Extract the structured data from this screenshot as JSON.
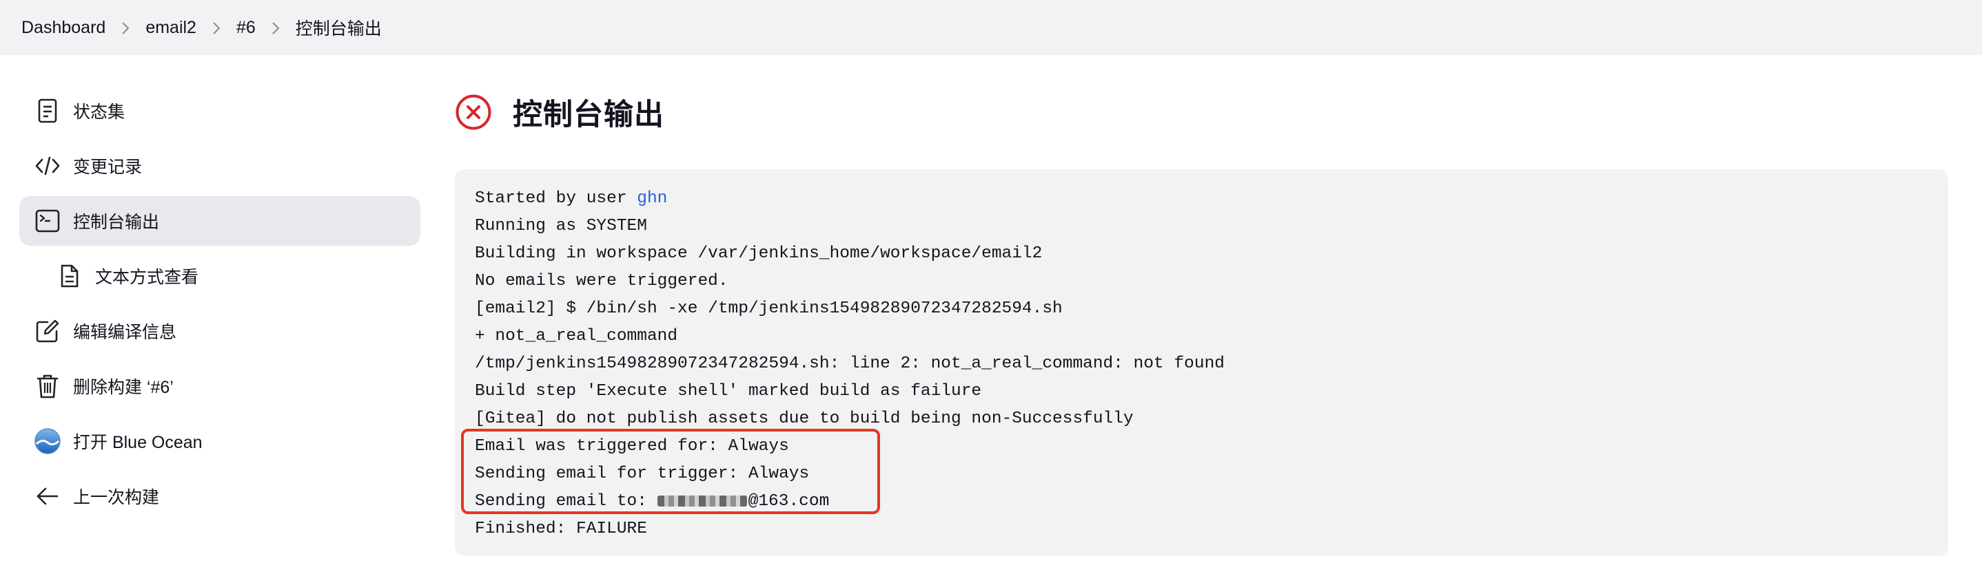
{
  "breadcrumb": {
    "items": [
      "Dashboard",
      "email2",
      "#6",
      "控制台输出"
    ]
  },
  "sidebar": {
    "items": [
      {
        "label": "状态集",
        "icon": "document-icon"
      },
      {
        "label": "变更记录",
        "icon": "code-icon"
      },
      {
        "label": "控制台输出",
        "icon": "terminal-icon",
        "active": true
      },
      {
        "label": "文本方式查看",
        "icon": "file-icon"
      },
      {
        "label": "编辑编译信息",
        "icon": "edit-icon"
      },
      {
        "label": "删除构建 ‘#6’",
        "icon": "trash-icon"
      },
      {
        "label": "打开 Blue Ocean",
        "icon": "blue-ocean-icon"
      },
      {
        "label": "上一次构建",
        "icon": "arrow-left-icon"
      }
    ]
  },
  "main": {
    "title": "控制台输出",
    "status": "failure",
    "status_color": "#d6262a"
  },
  "console": {
    "started_prefix": "Started by user ",
    "started_user": "ghn",
    "lines": [
      "Running as SYSTEM",
      "Building in workspace /var/jenkins_home/workspace/email2",
      "No emails were triggered.",
      "[email2] $ /bin/sh -xe /tmp/jenkins15498289072347282594.sh",
      "+ not_a_real_command",
      "/tmp/jenkins15498289072347282594.sh: line 2: not_a_real_command: not found",
      "Build step 'Execute shell' marked build as failure",
      "[Gitea] do not publish assets due to build being non-Successfully",
      "Email was triggered for: Always",
      "Sending email for trigger: Always"
    ],
    "sending_to_prefix": "Sending email to: ",
    "sending_to_suffix": "@163.com",
    "finished": "Finished: FAILURE"
  },
  "colors": {
    "link": "#2b5fd9",
    "highlight": "#e2381f",
    "active_bg": "#e8e8ee"
  }
}
